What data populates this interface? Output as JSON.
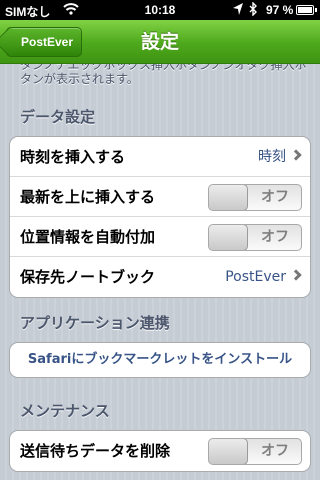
{
  "status_bar": {
    "carrier": "SIMなし",
    "time": "10:18",
    "battery_percent": "97 %",
    "battery_level": 0.97
  },
  "nav": {
    "back_label": "PostEver",
    "title": "設定"
  },
  "top_note_partial": [
    "タンノナエックホックス挿入ホタンノンオタク挿入ホ",
    "タンが表示されます。"
  ],
  "sections": {
    "data_settings": {
      "header": "データ設定",
      "rows": {
        "insert_time": {
          "label": "時刻を挿入する",
          "value": "時刻"
        },
        "insert_top": {
          "label": "最新を上に挿入する",
          "switch": "オフ",
          "on": false
        },
        "auto_location": {
          "label": "位置情報を自動付加",
          "switch": "オフ",
          "on": false
        },
        "notebook": {
          "label": "保存先ノートブック",
          "value": "PostEver"
        }
      }
    },
    "app_integration": {
      "header": "アプリケーション連携",
      "bookmarklet": "Safariにブックマークレットをインストール"
    },
    "maintenance": {
      "header": "メンテナンス",
      "rows": {
        "delete_pending": {
          "label": "送信待ちデータを削除",
          "switch": "オフ",
          "on": false
        }
      }
    }
  }
}
